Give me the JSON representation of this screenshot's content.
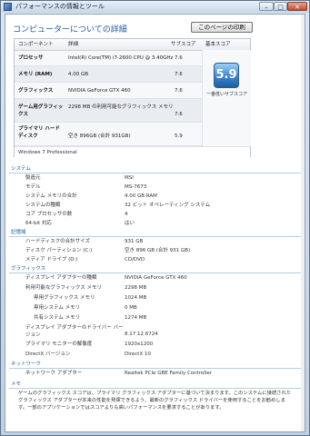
{
  "window": {
    "title": "パフォーマンスの情報とツール",
    "minimize": "–",
    "maximize": "□",
    "close": "✕"
  },
  "header": {
    "heading": "コンピューターについての詳細",
    "print_button": "このページの印刷"
  },
  "score_table": {
    "columns": [
      "コンポーネント",
      "詳細",
      "サブスコア",
      "基本スコア"
    ],
    "rows": [
      {
        "component": "プロセッサ",
        "detail": "Intel(R) Core(TM) i7-2600 CPU @ 3.40GHz",
        "score": "7.6"
      },
      {
        "component": "メモリ (RAM)",
        "detail": "4.00 GB",
        "score": "7.6"
      },
      {
        "component": "グラフィックス",
        "detail": "NVIDIA GeForce GTX 460",
        "score": "7.6"
      },
      {
        "component": "ゲーム用グラフィックス",
        "detail": "2298 MB の利用可能なグラフィックス メモリ",
        "score": "7.6"
      },
      {
        "component": "プライマリ ハード ディスク",
        "detail": "空き 896GB (合計 931GB)",
        "score": "5.9"
      }
    ],
    "base_score": "5.9",
    "base_caption": "一番低いサブスコア",
    "os": "Windows 7 Professional"
  },
  "sections": {
    "system": {
      "title": "システム",
      "items": [
        {
          "label": "製造元",
          "value": "MSI"
        },
        {
          "label": "モデル",
          "value": "MS-7673"
        },
        {
          "label": "システム メモリの合計",
          "value": "4.00 GB RAM"
        },
        {
          "label": "システムの種類",
          "value": "32 ビット オペレーティング システム"
        },
        {
          "label": "コア プロセッサの数",
          "value": "4"
        },
        {
          "label": "64-bit 対応",
          "value": "はい"
        }
      ]
    },
    "storage": {
      "title": "記憶域",
      "items": [
        {
          "label": "ハードディスクの合計サイズ",
          "value": "931 GB"
        },
        {
          "label": "ディスク パーティション (C:)",
          "value": "空き 896 GB (合計 931 GB)"
        },
        {
          "label": "メディア ドライブ (D:)",
          "value": "CD/DVD"
        }
      ]
    },
    "graphics": {
      "title": "グラフィックス",
      "items": [
        {
          "label": "ディスプレイ アダプターの種類",
          "value": "NVIDIA GeForce GTX 460"
        },
        {
          "label": "利用可能なグラフィックス メモリ",
          "value": "2298 MB"
        },
        {
          "label": "専用グラフィックス メモリ",
          "value": "1024 MB"
        },
        {
          "label": "専用システム メモリ",
          "value": "0 MB"
        },
        {
          "label": "共有システム メモリ",
          "value": "1274 MB"
        },
        {
          "label": "ディスプレイ アダプターのドライバー バージョン",
          "value": "8.17.12.6724"
        },
        {
          "label": "プライマリ モニターの解像度",
          "value": "1920x1200"
        },
        {
          "label": "DirectX バージョン",
          "value": "DirectX 10"
        }
      ]
    },
    "network": {
      "title": "ネットワーク",
      "items": [
        {
          "label": "ネットワーク アダプター",
          "value": "Realtek PCIe GBE Family Controller"
        }
      ]
    },
    "notes": {
      "title": "メモ",
      "text": "ゲームのグラフィックス スコアは、プライマリ グラフィックス アダプターに基づいて決まります。このシステムに接続されたグラフィックス アダプターが本来の性能を発揮できるよう、最新のグラフィックス ドライバーを使用することをお勧めします。一部のアプリケーションではスコアよりも高いパフォーマンスを要求することがあります。"
    }
  }
}
